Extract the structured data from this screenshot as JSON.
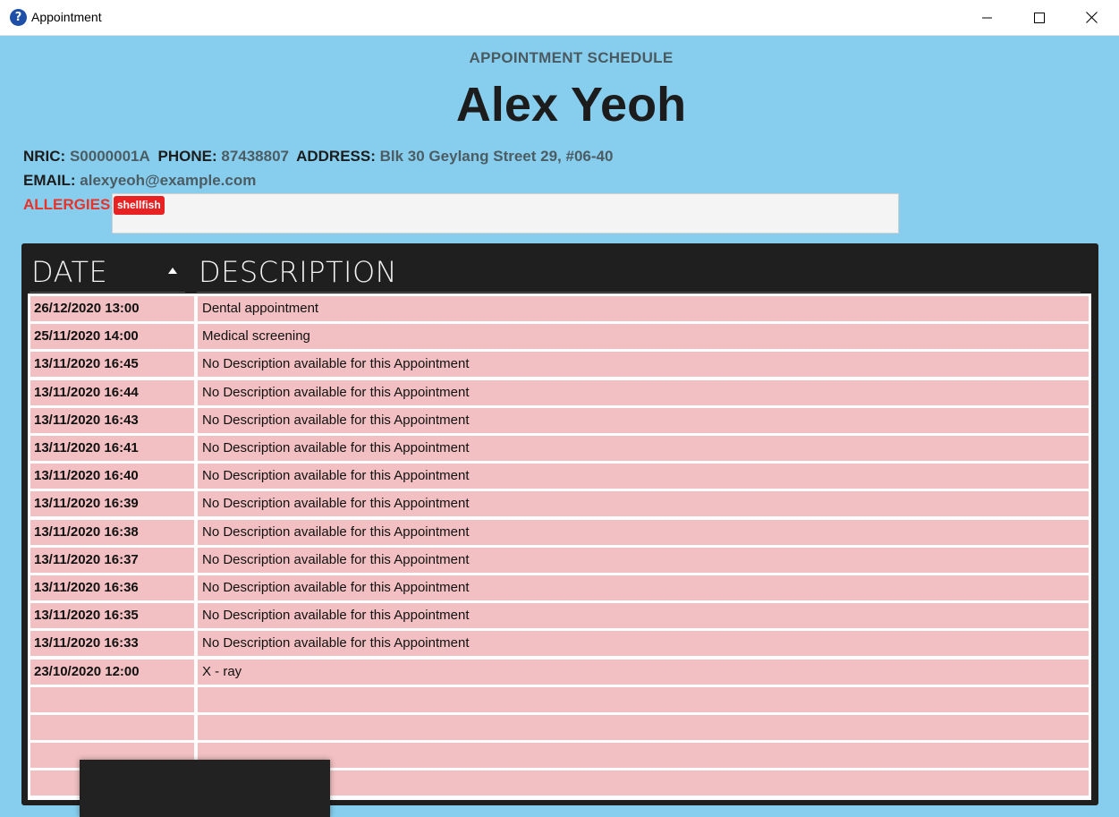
{
  "window": {
    "title": "Appointment",
    "icon": "help-question-icon",
    "controls": [
      "minimize-icon",
      "maximize-icon",
      "close-icon"
    ]
  },
  "header": {
    "subtitle": "APPOINTMENT SCHEDULE",
    "name": "Alex Yeoh"
  },
  "patient": {
    "nric_label": "NRIC:",
    "nric": "S0000001A",
    "phone_label": "PHONE:",
    "phone": "87438807",
    "address_label": "ADDRESS:",
    "address": "Blk 30 Geylang Street 29, #06-40",
    "email_label": "EMAIL:",
    "email": "alexyeoh@example.com",
    "allergies_label": "ALLERGIES:",
    "allergies": [
      "shellfish"
    ]
  },
  "table": {
    "columns": [
      "DATE",
      "DESCRIPTION"
    ],
    "sort": {
      "column": "DATE",
      "direction": "ascending-icon"
    },
    "rows": [
      {
        "date": "26/12/2020 13:00",
        "description": "Dental appointment"
      },
      {
        "date": "25/11/2020 14:00",
        "description": "Medical screening"
      },
      {
        "date": "13/11/2020 16:45",
        "description": "No Description available for this Appointment"
      },
      {
        "date": "13/11/2020 16:44",
        "description": "No Description available for this Appointment"
      },
      {
        "date": "13/11/2020 16:43",
        "description": "No Description available for this Appointment"
      },
      {
        "date": "13/11/2020 16:41",
        "description": "No Description available for this Appointment"
      },
      {
        "date": "13/11/2020 16:40",
        "description": "No Description available for this Appointment"
      },
      {
        "date": "13/11/2020 16:39",
        "description": "No Description available for this Appointment"
      },
      {
        "date": "13/11/2020 16:38",
        "description": "No Description available for this Appointment"
      },
      {
        "date": "13/11/2020 16:37",
        "description": "No Description available for this Appointment"
      },
      {
        "date": "13/11/2020 16:36",
        "description": "No Description available for this Appointment"
      },
      {
        "date": "13/11/2020 16:35",
        "description": "No Description available for this Appointment"
      },
      {
        "date": "13/11/2020 16:33",
        "description": "No Description available for this Appointment"
      },
      {
        "date": "23/10/2020 12:00",
        "description": "X - ray"
      },
      {
        "date": "",
        "description": ""
      },
      {
        "date": "",
        "description": ""
      },
      {
        "date": "",
        "description": ""
      },
      {
        "date": "",
        "description": ""
      }
    ]
  },
  "colors": {
    "background": "#87ceee",
    "row_fill": "#f2c0c2",
    "allergy": "#e8322a",
    "table_panel": "#1f1f1f"
  }
}
